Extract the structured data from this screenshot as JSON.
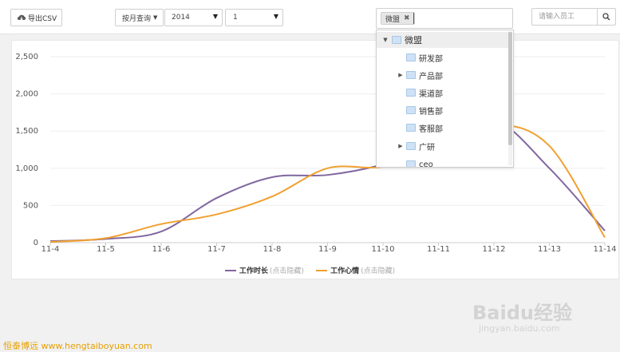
{
  "toolbar": {
    "export_label": "导出CSV",
    "mode_label": "按月查询",
    "year_value": "2014",
    "month_value": "1",
    "dept_tag": "微盟",
    "search_placeholder": "请输入员工"
  },
  "tree": {
    "root": "微盟",
    "children": [
      "研发部",
      "产品部",
      "渠道部",
      "销售部",
      "客服部",
      "广研",
      "ceo"
    ]
  },
  "chart_data": {
    "type": "line",
    "categories": [
      "11-4",
      "11-5",
      "11-6",
      "11-7",
      "11-8",
      "11-9",
      "11-10",
      "11-11",
      "11-12",
      "11-13",
      "11-14"
    ],
    "ylim": [
      0,
      2500
    ],
    "yticks": [
      "0",
      "500",
      "1,000",
      "1,500",
      "2,000",
      "2,500"
    ],
    "grid": true,
    "legend_position": "bottom",
    "series": [
      {
        "name": "工作时长",
        "color": "#8067a0",
        "values": [
          20,
          50,
          150,
          600,
          880,
          910,
          1050,
          1300,
          1640,
          1000,
          160
        ]
      },
      {
        "name": "工作心情",
        "color": "#f0a030",
        "values": [
          10,
          60,
          250,
          380,
          620,
          1000,
          1020,
          1250,
          1580,
          1300,
          70
        ]
      }
    ],
    "legend_hint": "(点击隐藏)"
  },
  "watermark": {
    "left": "恒泰博远 www.hengtaiboyuan.com",
    "right": "Baidu经验",
    "right_sub": "jingyan.baidu.com"
  }
}
